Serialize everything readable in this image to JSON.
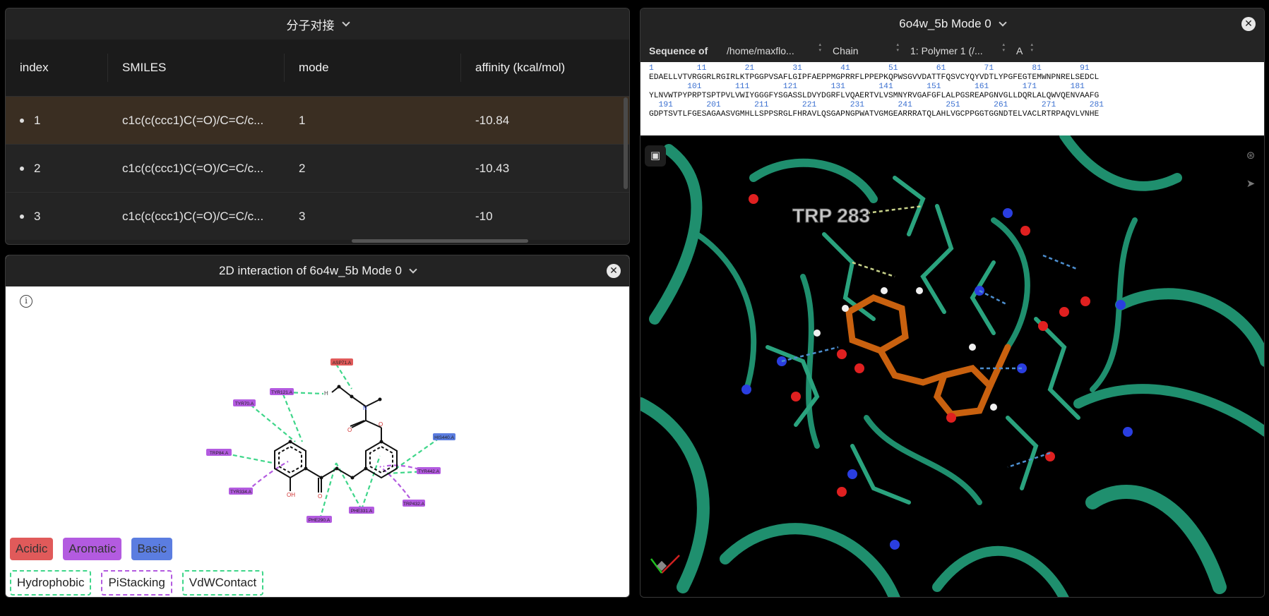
{
  "table_panel": {
    "title": "分子对接",
    "columns": [
      "index",
      "SMILES",
      "mode",
      "affinity (kcal/mol)"
    ],
    "rows": [
      {
        "index": "1",
        "smiles": "c1c(c(ccc1)C(=O)/C=C/c...",
        "mode": "1",
        "affinity": "-10.84"
      },
      {
        "index": "2",
        "smiles": "c1c(c(ccc1)C(=O)/C=C/c...",
        "mode": "2",
        "affinity": "-10.43"
      },
      {
        "index": "3",
        "smiles": "c1c(c(ccc1)C(=O)/C=C/c...",
        "mode": "3",
        "affinity": "-10"
      }
    ]
  },
  "interaction_panel": {
    "title": "2D interaction of 6o4w_5b Mode 0",
    "residues": {
      "asp": "ASP71.A",
      "tyr121": "TYR121.A",
      "tyr70": "TYR70.A",
      "trp84": "TRP84.A",
      "tyr334": "TYR334.A",
      "his440": "HIS440.A",
      "tyr442": "TYR442.A",
      "trp432": "TRP432.A",
      "phe331": "PHE331.A",
      "phe290": "PHE290.A"
    },
    "atoms": {
      "h": "H",
      "n": "N",
      "o1": "O",
      "o2": "O",
      "o3": "O",
      "oh": "OH"
    },
    "legend_types": [
      "Acidic",
      "Aromatic",
      "Basic"
    ],
    "legend_interactions": [
      "Hydrophobic",
      "PiStacking",
      "VdWContact"
    ],
    "colors": {
      "acidic": "#e05a5a",
      "aromatic": "#b35be0",
      "basic": "#5b7de0",
      "hydrophobic": "#3fd68a",
      "pistacking": "#b35be0",
      "vdw": "#3fd68a"
    }
  },
  "viewer_panel": {
    "title": "6o4w_5b Mode 0",
    "sequence_label": "Sequence of",
    "path_select": "/home/maxflo...",
    "chain_label": "Chain",
    "polymer_select": "1: Polymer 1 (/...",
    "chain_select": "A",
    "seq_nums_1": "1         11        21        31        41        51        61        71        81        91",
    "seq_line_1": "EDAELLVTVRGGRLRGIRLKTPGGPVSAFLGIPFAEPPMGPRRFLPPEPKQPWSGVVDATTFQSVCYQYVDTLYPGFEGTEMWNPNRELSEDCL",
    "seq_nums_2": "        101       111       121       131       141       151       161       171       181",
    "seq_line_2": "YLNVWTPYPRPTSPTPVLVWIYGGGFYSGASSLDVYDGRFLVQAERTVLVSMNYRVGAFGFLALPGSREAPGNVGLLDQRLALQWVQENVAAFG",
    "seq_nums_3": "  191       201       211       221       231       241       251       261       271       281",
    "seq_line_3": "GDPTSVTLFGESAGAASVGMHLLSPPSRGLFHRAVLQSGAPNGPWATVGMGEARRRATQLAHLVGCPPGGTGGNDTELVACLRTRPAQVLVNHE",
    "residue_label": "TRP 283"
  }
}
